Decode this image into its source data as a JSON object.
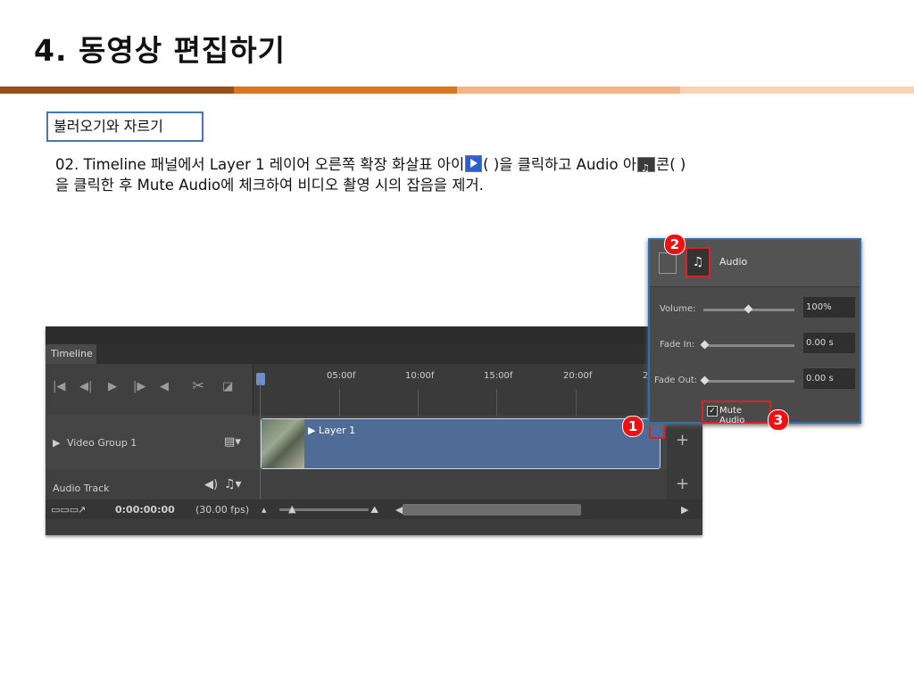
{
  "slide": {
    "title": "4. 동영상 편집하기",
    "section_label": "불러오기와 자르기",
    "instruction": {
      "part1": "02. Timeline 패널에서 Layer 1 레이어 오른쪽 확장 화살표 아이",
      "part2": "(    )을 클릭하고 Audio 아",
      "part3": "콘(    )",
      "line2": "을 클릭한 후 Mute Audio에 체크하여 비디오 촬영 시의 잡음을 제거."
    }
  },
  "timeline": {
    "panel_title": "Timeline",
    "ruler_labels": [
      "05:00f",
      "10:00f",
      "15:00f",
      "20:00f",
      "2"
    ],
    "tracks": {
      "video_group": "Video Group 1",
      "audio_track": "Audio Track"
    },
    "clip_name": "Layer 1",
    "timecode": "0:00:00:00",
    "fps": "(30.00 fps)",
    "badge_1": "1"
  },
  "audio_popup": {
    "title": "Audio",
    "badge_2": "2",
    "badge_3": "3",
    "volume_label": "Volume:",
    "volume_value": "100%",
    "fade_in_label": "Fade In:",
    "fade_in_value": "0.00 s",
    "fade_out_label": "Fade Out:",
    "fade_out_value": "0.00 s",
    "mute_label": "Mute Audio",
    "mute_checked": true,
    "volume_level": 0.5
  },
  "colors": {
    "accent_red": "#dd1111",
    "title_rule": [
      "#9a4f14",
      "#e0741e",
      "#f5b483",
      "#f9d3b6"
    ],
    "clip_blue": "#4e6c96"
  },
  "icons": [
    "play-icon",
    "audio-icon",
    "scissors-icon",
    "expand-arrow-icon",
    "music-note-icon"
  ]
}
